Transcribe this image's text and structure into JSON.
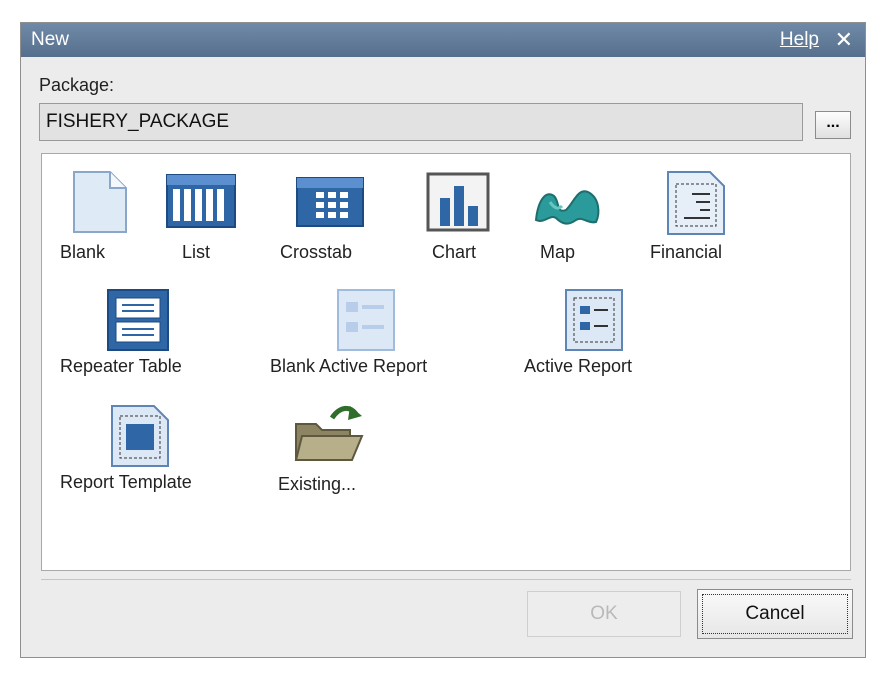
{
  "dialog": {
    "title": "New",
    "help_label": "Help",
    "close_glyph": "✕"
  },
  "package": {
    "label": "Package:",
    "value": "FISHERY_PACKAGE",
    "browse_label": "..."
  },
  "items": [
    {
      "label": "Blank",
      "icon": "blank-page-icon"
    },
    {
      "label": "List",
      "icon": "list-icon"
    },
    {
      "label": "Crosstab",
      "icon": "crosstab-icon"
    },
    {
      "label": "Chart",
      "icon": "chart-icon"
    },
    {
      "label": "Map",
      "icon": "map-icon"
    },
    {
      "label": "Financial",
      "icon": "financial-icon"
    },
    {
      "label": "Repeater Table",
      "icon": "repeater-table-icon"
    },
    {
      "label": "Blank Active Report",
      "icon": "blank-active-report-icon"
    },
    {
      "label": "Active Report",
      "icon": "active-report-icon"
    },
    {
      "label": "Report Template",
      "icon": "report-template-icon"
    },
    {
      "label": "Existing...",
      "icon": "open-folder-icon"
    }
  ],
  "buttons": {
    "ok_label": "OK",
    "cancel_label": "Cancel"
  },
  "colors": {
    "titlebar": "#5f7a98",
    "icon_blue": "#2f66a6",
    "map_teal": "#2a9a9a"
  }
}
